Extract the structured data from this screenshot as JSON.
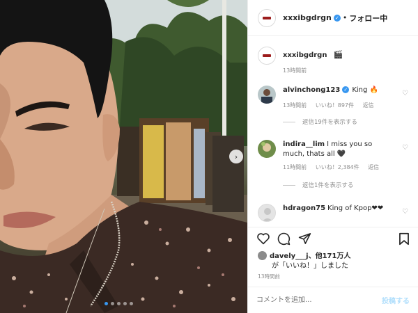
{
  "post": {
    "author": "xxxibgdrgn",
    "follow_dot": "•",
    "follow_status": "フォロー中",
    "caption_emoji": "🎬",
    "caption_time": "13時間前"
  },
  "comments": [
    {
      "user": "alvinchong123",
      "verified": true,
      "text": "King 🔥",
      "time": "13時間前",
      "likes": "いいね！897件",
      "reply": "返信",
      "view_replies": "返信19件を表示する"
    },
    {
      "user": "indira__lim",
      "verified": false,
      "text": "I miss you so much, thats all 🖤",
      "time": "11時間前",
      "likes": "いいね！2,384件",
      "reply": "返信",
      "view_replies": "返信1件を表示する"
    },
    {
      "user": "hdragon75",
      "verified": false,
      "text": "King of Kpop❤❤",
      "time": "",
      "likes": "",
      "reply": "",
      "view_replies": ""
    }
  ],
  "likes": {
    "user": "davely___j",
    "others": "、他171万人",
    "suffix": "が「いいね！」しました"
  },
  "timestamp": "13時間前",
  "comment_box": {
    "placeholder": "コメントを追加...",
    "post_label": "投稿する"
  },
  "icons": [
    "heart-icon",
    "comment-icon",
    "share-icon",
    "bookmark-icon",
    "verified-icon",
    "next-arrow-icon"
  ],
  "carousel": {
    "current": 1,
    "total": 5
  },
  "colors": {
    "verified": "#3897f0",
    "muted": "#8e8e8e",
    "post_disabled": "#b2dffc"
  }
}
